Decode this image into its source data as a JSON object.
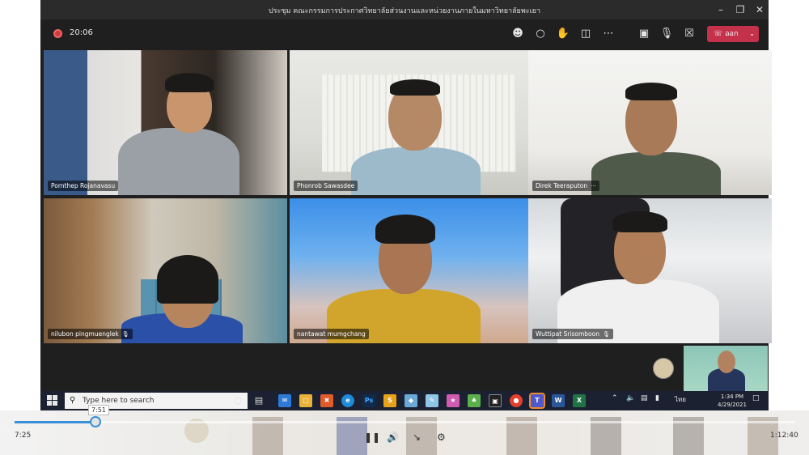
{
  "window": {
    "title": "ประชุม คณะกรรมการประกาศวิทยาลัยส่วนงานและหน่วยงานภายในมหาวิทยาลัยพะเยา"
  },
  "toolbar": {
    "recording_time": "20:06",
    "leave_label": "ออก"
  },
  "participants": [
    {
      "name": "Pornthep Rojanavasu"
    },
    {
      "name": "Phonrob Sawasdee"
    },
    {
      "name": "Direk Teeraputon",
      "more": "···"
    },
    {
      "name": "nilubon pingmuenglek"
    },
    {
      "name": "nantawat mumgchang"
    },
    {
      "name": "Wuttipat Srisomboon"
    }
  ],
  "taskbar": {
    "search_placeholder": "Type here to search",
    "language": "ไทย",
    "time": "1:34 PM",
    "date": "4/29/2021"
  },
  "player": {
    "current_time": "7:25",
    "hover_time": "7:51",
    "duration": "1:12:40",
    "progress_fraction": 0.104
  },
  "colors": {
    "leave": "#c4314b",
    "accent": "#3c90d8",
    "taskbar": "#1b2130"
  }
}
